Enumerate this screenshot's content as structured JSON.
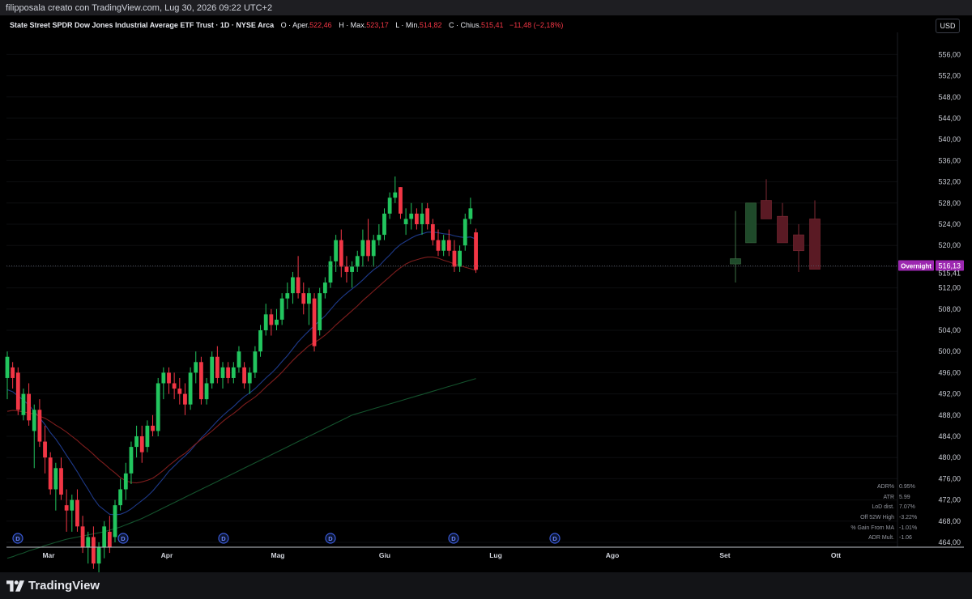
{
  "header": {
    "credit": "filipposala creato con TradingView.com, Lug 30, 2026 09:22 UTC+2",
    "symbol_line": "State Street SPDR Dow Jones Industrial Average ETF Trust · 1D · NYSE Arca",
    "ohlc": {
      "open_label": "O · Aper.",
      "open_value": "522,46",
      "high_label": "H · Max.",
      "high_value": "523,17",
      "low_label": "L · Min.",
      "low_value": "514,82",
      "close_label": "C · Chius.",
      "close_value": "515,41",
      "change_value": "−11,48 (−2,18%)"
    },
    "currency_button": "USD"
  },
  "footer": {
    "brand": "TradingView"
  },
  "colors": {
    "up": "#22c55e",
    "down": "#f23645",
    "ma_fast": "#1e3a8a",
    "ma_mid": "#7f1d1d",
    "ma_slow": "#14532d",
    "overnight_label": "#9c27b0"
  },
  "stats": [
    {
      "label": "ADR%",
      "value": "0.95%"
    },
    {
      "label": "ATR",
      "value": "5.99"
    },
    {
      "label": "LoD dist.",
      "value": "7.07%"
    },
    {
      "label": "Off 52W High",
      "value": "-3.22%"
    },
    {
      "label": "% Gain From MA",
      "value": "-1.01%"
    },
    {
      "label": "ADR Mult.",
      "value": "-1.06"
    }
  ],
  "chart_data": {
    "type": "candlestick",
    "y_range": [
      463,
      561
    ],
    "y_ticks": [
      "556,00",
      "552,00",
      "548,00",
      "544,00",
      "540,00",
      "536,00",
      "532,00",
      "528,00",
      "524,00",
      "520,00",
      "516,00",
      "512,00",
      "508,00",
      "504,00",
      "500,00",
      "496,00",
      "492,00",
      "488,00",
      "484,00",
      "480,00",
      "476,00",
      "472,00",
      "468,00",
      "464,00"
    ],
    "y_tick_values": [
      556,
      552,
      548,
      544,
      540,
      536,
      532,
      528,
      524,
      520,
      516,
      512,
      508,
      504,
      500,
      496,
      492,
      488,
      484,
      480,
      476,
      472,
      468,
      464
    ],
    "x_labels": [
      "Mar",
      "Apr",
      "Mag",
      "Giu",
      "Lug",
      "Ago",
      "Set",
      "Ott"
    ],
    "overnight": {
      "label": "Overnight",
      "value": "516,13",
      "price": 516.13
    },
    "last_price": {
      "label": "515,41",
      "price": 515.41
    },
    "dividend_marker": "D",
    "dividend_marker_count": 6,
    "candles": [
      {
        "o": 495,
        "h": 500,
        "l": 491,
        "c": 499
      },
      {
        "o": 497,
        "h": 498,
        "l": 493,
        "c": 495
      },
      {
        "o": 496,
        "h": 497,
        "l": 488,
        "c": 489
      },
      {
        "o": 488,
        "h": 493,
        "l": 487,
        "c": 492
      },
      {
        "o": 492,
        "h": 494,
        "l": 486,
        "c": 487
      },
      {
        "o": 485,
        "h": 490,
        "l": 478,
        "c": 489
      },
      {
        "o": 489,
        "h": 491,
        "l": 482,
        "c": 483
      },
      {
        "o": 483,
        "h": 486,
        "l": 477,
        "c": 480
      },
      {
        "o": 480,
        "h": 481,
        "l": 473,
        "c": 474
      },
      {
        "o": 474,
        "h": 479,
        "l": 470,
        "c": 478
      },
      {
        "o": 478,
        "h": 480,
        "l": 472,
        "c": 473
      },
      {
        "o": 471,
        "h": 474,
        "l": 466,
        "c": 470
      },
      {
        "o": 470,
        "h": 473,
        "l": 466,
        "c": 472
      },
      {
        "o": 472,
        "h": 474,
        "l": 466,
        "c": 467
      },
      {
        "o": 467,
        "h": 469,
        "l": 462,
        "c": 463
      },
      {
        "o": 463,
        "h": 466,
        "l": 460,
        "c": 465
      },
      {
        "o": 465,
        "h": 467,
        "l": 459,
        "c": 460
      },
      {
        "o": 460,
        "h": 464,
        "l": 458,
        "c": 463
      },
      {
        "o": 463,
        "h": 468,
        "l": 461,
        "c": 467
      },
      {
        "o": 466,
        "h": 469,
        "l": 462,
        "c": 463
      },
      {
        "o": 465,
        "h": 472,
        "l": 464,
        "c": 471
      },
      {
        "o": 471,
        "h": 476,
        "l": 470,
        "c": 474
      },
      {
        "o": 474,
        "h": 479,
        "l": 472,
        "c": 477
      },
      {
        "o": 477,
        "h": 483,
        "l": 475,
        "c": 482
      },
      {
        "o": 482,
        "h": 486,
        "l": 480,
        "c": 484
      },
      {
        "o": 484,
        "h": 486,
        "l": 479,
        "c": 481
      },
      {
        "o": 482,
        "h": 487,
        "l": 481,
        "c": 486
      },
      {
        "o": 486,
        "h": 488,
        "l": 484,
        "c": 485
      },
      {
        "o": 485,
        "h": 495,
        "l": 484,
        "c": 494
      },
      {
        "o": 494,
        "h": 497,
        "l": 491,
        "c": 496
      },
      {
        "o": 496,
        "h": 497,
        "l": 492,
        "c": 494
      },
      {
        "o": 494,
        "h": 496,
        "l": 491,
        "c": 493
      },
      {
        "o": 493,
        "h": 495,
        "l": 490,
        "c": 492
      },
      {
        "o": 492,
        "h": 494,
        "l": 488,
        "c": 490
      },
      {
        "o": 490,
        "h": 497,
        "l": 489,
        "c": 496
      },
      {
        "o": 496,
        "h": 500,
        "l": 494,
        "c": 498
      },
      {
        "o": 498,
        "h": 499,
        "l": 490,
        "c": 491
      },
      {
        "o": 491,
        "h": 495,
        "l": 490,
        "c": 494
      },
      {
        "o": 494,
        "h": 500,
        "l": 493,
        "c": 499
      },
      {
        "o": 499,
        "h": 501,
        "l": 494,
        "c": 495
      },
      {
        "o": 495,
        "h": 498,
        "l": 493,
        "c": 497
      },
      {
        "o": 497,
        "h": 498,
        "l": 494,
        "c": 495
      },
      {
        "o": 495,
        "h": 498,
        "l": 494,
        "c": 497
      },
      {
        "o": 497,
        "h": 501,
        "l": 496,
        "c": 500
      },
      {
        "o": 497,
        "h": 498,
        "l": 493,
        "c": 494
      },
      {
        "o": 494,
        "h": 497,
        "l": 492,
        "c": 496
      },
      {
        "o": 496,
        "h": 501,
        "l": 495,
        "c": 500
      },
      {
        "o": 500,
        "h": 505,
        "l": 499,
        "c": 504
      },
      {
        "o": 504,
        "h": 509,
        "l": 503,
        "c": 507
      },
      {
        "o": 507,
        "h": 508,
        "l": 503,
        "c": 505
      },
      {
        "o": 505,
        "h": 508,
        "l": 504,
        "c": 506
      },
      {
        "o": 506,
        "h": 511,
        "l": 505,
        "c": 510
      },
      {
        "o": 510,
        "h": 513,
        "l": 508,
        "c": 511
      },
      {
        "o": 511,
        "h": 515,
        "l": 509,
        "c": 514
      },
      {
        "o": 514,
        "h": 518,
        "l": 510,
        "c": 511
      },
      {
        "o": 511,
        "h": 513,
        "l": 507,
        "c": 509
      },
      {
        "o": 509,
        "h": 512,
        "l": 505,
        "c": 511
      },
      {
        "o": 510,
        "h": 511,
        "l": 500,
        "c": 501
      },
      {
        "o": 504,
        "h": 512,
        "l": 503,
        "c": 511
      },
      {
        "o": 511,
        "h": 514,
        "l": 510,
        "c": 513
      },
      {
        "o": 513,
        "h": 518,
        "l": 512,
        "c": 517
      },
      {
        "o": 517,
        "h": 522,
        "l": 515,
        "c": 521
      },
      {
        "o": 521,
        "h": 523,
        "l": 514,
        "c": 516
      },
      {
        "o": 516,
        "h": 518,
        "l": 513,
        "c": 515
      },
      {
        "o": 515,
        "h": 517,
        "l": 512,
        "c": 516
      },
      {
        "o": 516,
        "h": 519,
        "l": 515,
        "c": 518
      },
      {
        "o": 518,
        "h": 523,
        "l": 516,
        "c": 521
      },
      {
        "o": 521,
        "h": 525,
        "l": 517,
        "c": 518
      },
      {
        "o": 518,
        "h": 522,
        "l": 516,
        "c": 521
      },
      {
        "o": 521,
        "h": 524,
        "l": 520,
        "c": 522
      },
      {
        "o": 522,
        "h": 527,
        "l": 521,
        "c": 526
      },
      {
        "o": 526,
        "h": 530,
        "l": 525,
        "c": 529
      },
      {
        "o": 529,
        "h": 533,
        "l": 528,
        "c": 530
      },
      {
        "o": 531,
        "h": 531,
        "l": 525,
        "c": 526
      },
      {
        "o": 524,
        "h": 527,
        "l": 522,
        "c": 525
      },
      {
        "o": 525,
        "h": 528,
        "l": 523,
        "c": 526
      },
      {
        "o": 526,
        "h": 527,
        "l": 523,
        "c": 524
      },
      {
        "o": 524,
        "h": 528,
        "l": 522,
        "c": 526
      },
      {
        "o": 527,
        "h": 528,
        "l": 523,
        "c": 524
      },
      {
        "o": 524,
        "h": 525,
        "l": 520,
        "c": 521
      },
      {
        "o": 521,
        "h": 523,
        "l": 518,
        "c": 519
      },
      {
        "o": 519,
        "h": 522,
        "l": 518,
        "c": 521
      },
      {
        "o": 521,
        "h": 523,
        "l": 518,
        "c": 519
      },
      {
        "o": 519,
        "h": 521,
        "l": 515,
        "c": 516
      },
      {
        "o": 516,
        "h": 520,
        "l": 515,
        "c": 519
      },
      {
        "o": 520,
        "h": 526,
        "l": 519,
        "c": 525
      },
      {
        "o": 525,
        "h": 529,
        "l": 524,
        "c": 527
      },
      {
        "o": 522.46,
        "h": 523.17,
        "l": 514.82,
        "c": 515.41
      }
    ],
    "projection": [
      {
        "o": 516.5,
        "h": 526.5,
        "l": 513,
        "c": 517.5
      },
      {
        "o": 520.5,
        "h": 528,
        "l": 520.5,
        "c": 528
      },
      {
        "o": 528.5,
        "h": 532.5,
        "l": 525,
        "c": 525
      },
      {
        "o": 525.5,
        "h": 528,
        "l": 520.5,
        "c": 520.5
      },
      {
        "o": 522,
        "h": 524,
        "l": 515,
        "c": 519
      },
      {
        "o": 525,
        "h": 528.5,
        "l": 515.5,
        "c": 515.5
      }
    ],
    "moving_averages": [
      {
        "name": "fast",
        "values": [
          492.8,
          492.4,
          491.6,
          490.8,
          489.9,
          488.7,
          487.5,
          486.2,
          484.7,
          483.5,
          482,
          480.4,
          478.9,
          477.3,
          475.6,
          474,
          472.3,
          470.9,
          470.1,
          469.3,
          469.2,
          469.3,
          469.7,
          470.3,
          471.1,
          471.9,
          472.7,
          473.7,
          474.9,
          476.1,
          477.4,
          478.4,
          479.4,
          480.3,
          481.3,
          482.5,
          483.7,
          484.7,
          485.8,
          486.9,
          487.9,
          488.8,
          489.6,
          490.6,
          491.5,
          492.2,
          493,
          494,
          495,
          495.9,
          496.9,
          498.1,
          499.2,
          500.5,
          501.8,
          502.9,
          503.9,
          504.9,
          505.8,
          506.7,
          507.9,
          509.1,
          510.1,
          511,
          511.8,
          512.6,
          513.5,
          514.5,
          515.4,
          516.1,
          517.2,
          518.2,
          519.3,
          520.2,
          520.8,
          521.4,
          521.9,
          522.2,
          522.5,
          522.5,
          522.4,
          522.2,
          522.1,
          521.8,
          521.6,
          521.5,
          521.6,
          521.2
        ]
      },
      {
        "name": "mid",
        "values": [
          488.7,
          488.9,
          488.8,
          488.6,
          488.4,
          488.2,
          487.8,
          487.4,
          486.8,
          486.1,
          485.5,
          484.8,
          484,
          483.2,
          482.3,
          481.5,
          480.6,
          479.6,
          478.8,
          477.9,
          477.1,
          476.2,
          475.6,
          475.3,
          475.2,
          475.4,
          475.7,
          476.1,
          476.8,
          477.6,
          478.5,
          479.3,
          480.1,
          480.8,
          481.7,
          482.6,
          483.4,
          484.2,
          485,
          485.9,
          486.8,
          487.6,
          488.3,
          489.1,
          490,
          490.7,
          491.4,
          492.3,
          493.3,
          494.2,
          495.1,
          496.1,
          497.2,
          498.3,
          499.3,
          500.2,
          501.1,
          501.7,
          502.3,
          503.1,
          504,
          505,
          505.9,
          506.8,
          507.7,
          508.6,
          509.6,
          510.5,
          511.4,
          512.3,
          513.2,
          514.1,
          515,
          515.8,
          516.5,
          517,
          517.3,
          517.6,
          517.8,
          517.8,
          517.6,
          517.2,
          516.9,
          516.5,
          516.2,
          515.9,
          515.6,
          515.3
        ]
      },
      {
        "name": "slow",
        "values": [
          461,
          461.3,
          461.7,
          462,
          462.4,
          462.7,
          463,
          463.4,
          463.7,
          464,
          464.3,
          464.6,
          464.8,
          465,
          465.2,
          465.4,
          465.6,
          465.8,
          466,
          466.3,
          466.6,
          466.9,
          467.3,
          467.7,
          468.1,
          468.5,
          469,
          469.5,
          470,
          470.5,
          471,
          471.5,
          472,
          472.5,
          473,
          473.5,
          474,
          474.5,
          475,
          475.5,
          476,
          476.5,
          477,
          477.5,
          478,
          478.5,
          479,
          479.5,
          480,
          480.5,
          481,
          481.5,
          482,
          482.5,
          483,
          483.5,
          484,
          484.5,
          485,
          485.5,
          486,
          486.5,
          487,
          487.5,
          488,
          488.3,
          488.6,
          488.9,
          489.2,
          489.5,
          489.8,
          490.1,
          490.4,
          490.7,
          491,
          491.3,
          491.6,
          491.9,
          492.2,
          492.5,
          492.8,
          493.1,
          493.4,
          493.7,
          494,
          494.3,
          494.6,
          494.9
        ]
      }
    ]
  }
}
